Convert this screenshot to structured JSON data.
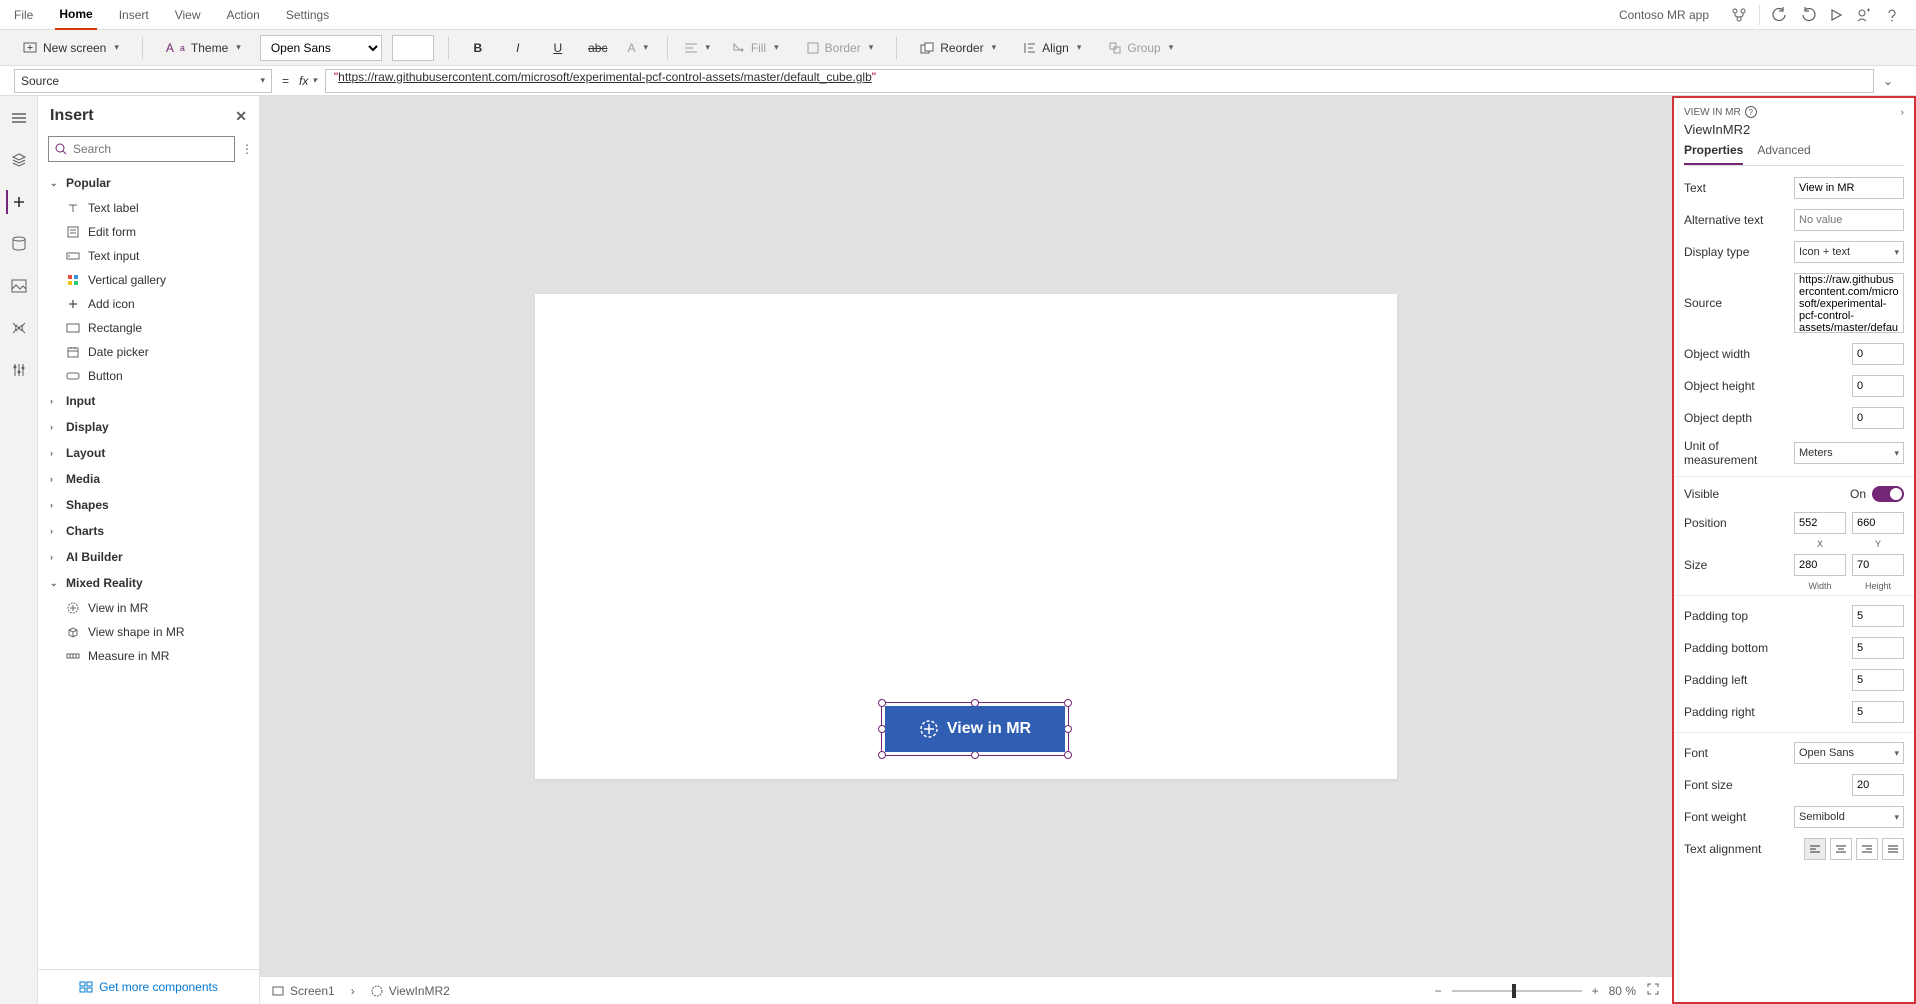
{
  "app_name": "Contoso MR app",
  "menu_tabs": [
    "File",
    "Home",
    "Insert",
    "View",
    "Action",
    "Settings"
  ],
  "active_tab": "Home",
  "ribbon": {
    "new_screen": "New screen",
    "theme": "Theme",
    "font": "Open Sans",
    "fill": "Fill",
    "border": "Border",
    "reorder": "Reorder",
    "align": "Align",
    "group": "Group"
  },
  "formula": {
    "property": "Source",
    "value": "\"https://raw.githubusercontent.com/microsoft/experimental-pcf-control-assets/master/default_cube.glb\"",
    "open_quote": "\"",
    "url": "https://raw.githubusercontent.com/microsoft/experimental-pcf-control-assets/master/default_cube.glb",
    "close_quote": "\""
  },
  "insert": {
    "title": "Insert",
    "search_placeholder": "Search",
    "categories": {
      "popular": {
        "label": "Popular",
        "items": [
          "Text label",
          "Edit form",
          "Text input",
          "Vertical gallery",
          "Add icon",
          "Rectangle",
          "Date picker",
          "Button"
        ]
      },
      "collapsed": [
        "Input",
        "Display",
        "Layout",
        "Media",
        "Shapes",
        "Charts",
        "AI Builder"
      ],
      "mixed_reality": {
        "label": "Mixed Reality",
        "items": [
          "View in MR",
          "View shape in MR",
          "Measure in MR"
        ]
      }
    },
    "footer": "Get more components"
  },
  "canvas": {
    "button_label": "View in MR"
  },
  "breadcrumb": {
    "screen": "Screen1",
    "control": "ViewInMR2"
  },
  "zoom": {
    "value": "80",
    "suffix": "%"
  },
  "properties": {
    "panel_label": "VIEW IN MR",
    "control_name": "ViewInMR2",
    "tabs": [
      "Properties",
      "Advanced"
    ],
    "active_tab": "Properties",
    "text": {
      "label": "Text",
      "value": "View in MR"
    },
    "alt_text": {
      "label": "Alternative text",
      "placeholder": "No value"
    },
    "display_type": {
      "label": "Display type",
      "value": "Icon + text"
    },
    "source": {
      "label": "Source",
      "value": "https://raw.githubusercontent.com/microsoft/experimental-pcf-control-assets/master/default_"
    },
    "object_width": {
      "label": "Object width",
      "value": "0"
    },
    "object_height": {
      "label": "Object height",
      "value": "0"
    },
    "object_depth": {
      "label": "Object depth",
      "value": "0"
    },
    "unit": {
      "label": "Unit of measurement",
      "value": "Meters"
    },
    "visible": {
      "label": "Visible",
      "value": "On"
    },
    "position": {
      "label": "Position",
      "x": "552",
      "y": "660",
      "xlabel": "X",
      "ylabel": "Y"
    },
    "size": {
      "label": "Size",
      "w": "280",
      "h": "70",
      "wlabel": "Width",
      "hlabel": "Height"
    },
    "padding_top": {
      "label": "Padding top",
      "value": "5"
    },
    "padding_bottom": {
      "label": "Padding bottom",
      "value": "5"
    },
    "padding_left": {
      "label": "Padding left",
      "value": "5"
    },
    "padding_right": {
      "label": "Padding right",
      "value": "5"
    },
    "font": {
      "label": "Font",
      "value": "Open Sans"
    },
    "font_size": {
      "label": "Font size",
      "value": "20"
    },
    "font_weight": {
      "label": "Font weight",
      "value": "Semibold"
    },
    "text_align": {
      "label": "Text alignment"
    }
  }
}
